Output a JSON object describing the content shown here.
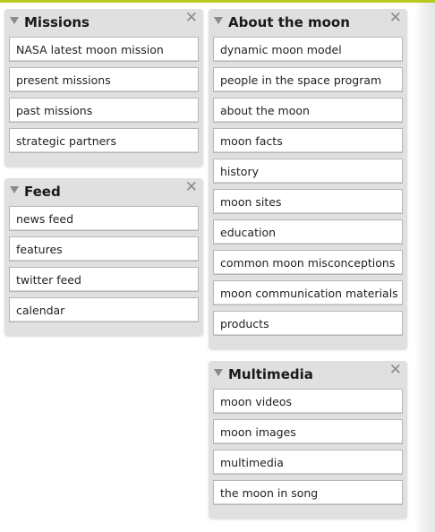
{
  "panels": {
    "missions": {
      "title": "Missions",
      "close_glyph": "✕",
      "items": [
        "NASA latest moon mission",
        "present missions",
        "past missions",
        "strategic partners"
      ]
    },
    "feed": {
      "title": "Feed",
      "close_glyph": "✕",
      "items": [
        "news feed",
        "features",
        "twitter feed",
        "calendar"
      ]
    },
    "about": {
      "title": "About the moon",
      "close_glyph": "✕",
      "items": [
        "dynamic moon model",
        "people in the space program",
        "about the moon",
        "moon facts",
        "history",
        "moon sites",
        "education",
        "common moon misconceptions",
        "moon communication materials",
        "products"
      ]
    },
    "multimedia": {
      "title": "Multimedia",
      "close_glyph": "✕",
      "items": [
        "moon videos",
        "moon images",
        "multimedia",
        "the moon in song"
      ]
    }
  },
  "colors": {
    "accent_bar": "#b5cc1c",
    "panel_bg": "#e0e0e0",
    "item_border": "#b7b7b7"
  }
}
